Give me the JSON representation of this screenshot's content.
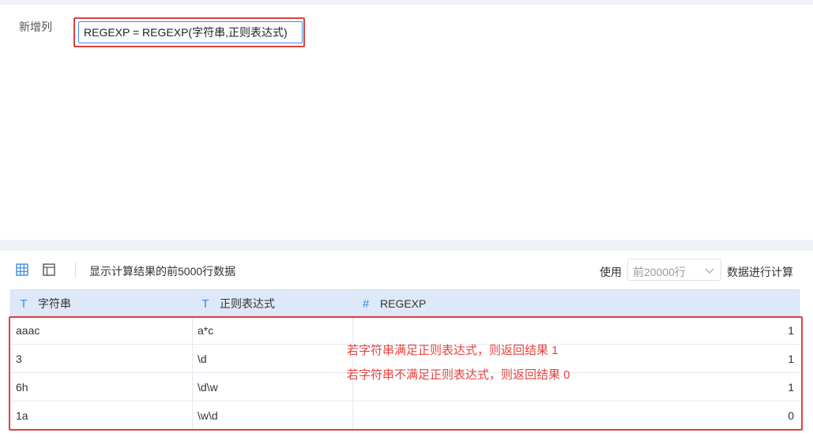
{
  "editor": {
    "field_label": "新增列",
    "formula": "REGEXP = REGEXP(字符串,正则表达式)"
  },
  "toolbar": {
    "grid_view_icon": "grid-icon",
    "panel_view_icon": "layout-icon",
    "caption": "显示计算结果的前5000行数据",
    "use_label": "使用",
    "rows_select_value": "前20000行",
    "calc_label": "数据进行计算"
  },
  "table": {
    "columns": [
      {
        "type_icon": "T",
        "label": "字符串"
      },
      {
        "type_icon": "T",
        "label": "正则表达式"
      },
      {
        "type_icon": "#",
        "label": "REGEXP"
      }
    ],
    "rows": [
      {
        "c1": "aaac",
        "c2": "a*c",
        "c3": "1"
      },
      {
        "c1": "3",
        "c2": "\\d",
        "c3": "1"
      },
      {
        "c1": "6h",
        "c2": "\\d\\w",
        "c3": "1"
      },
      {
        "c1": "1a",
        "c2": "\\w\\d",
        "c3": "0"
      }
    ]
  },
  "annotations": {
    "line1": "若字符串满足正则表达式，则返回结果 1",
    "line2": "若字符串不满足正则表达式，则返回结果 0"
  },
  "colors": {
    "accent_blue": "#3b8de0",
    "highlight_red": "#e0403f",
    "header_bg": "#dde9f8"
  }
}
